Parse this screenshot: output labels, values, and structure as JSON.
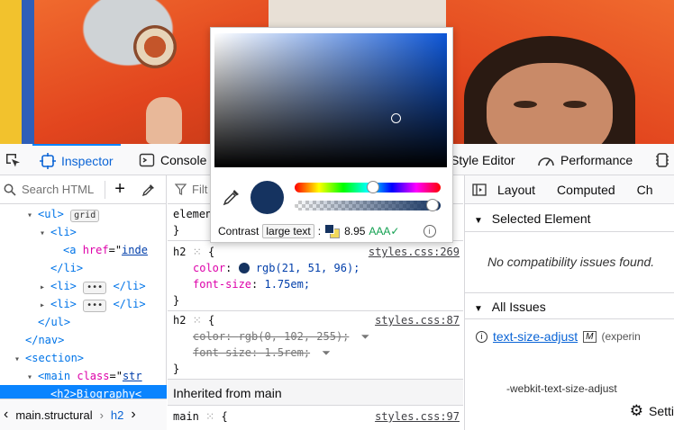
{
  "toolbar": {
    "inspector_label": "Inspector",
    "console_label": "Console",
    "style_editor_label": "Style Editor",
    "performance_label": "Performance"
  },
  "markup": {
    "search_placeholder": "Search HTML",
    "rows": [
      {
        "indent": 2,
        "twisty": "▾",
        "open": "<ul>",
        "badge": "grid"
      },
      {
        "indent": 3,
        "twisty": "▾",
        "open": "<li>"
      },
      {
        "indent": 4,
        "twisty": "",
        "open": "<a",
        "attr": "href",
        "val": "inde"
      },
      {
        "indent": 3,
        "twisty": "",
        "open": "</li>"
      },
      {
        "indent": 3,
        "twisty": "▸",
        "open": "<li>",
        "badge": "•••",
        "close": "</li>"
      },
      {
        "indent": 3,
        "twisty": "▸",
        "open": "<li>",
        "badge": "•••",
        "close": "</li>"
      },
      {
        "indent": 2,
        "twisty": "",
        "open": "</ul>"
      },
      {
        "indent": 1,
        "twisty": "",
        "open": "</nav>"
      },
      {
        "indent": 1,
        "twisty": "▾",
        "open": "<section>"
      },
      {
        "indent": 2,
        "twisty": "▾",
        "open": "<main",
        "attr": "class",
        "val": "str"
      },
      {
        "indent": 3,
        "twisty": "",
        "open": "<h2>Biography<",
        "selected": true
      }
    ],
    "breadcrumbs": [
      "main.structural",
      "h2"
    ]
  },
  "rules": {
    "filter_placeholder": "Filt",
    "element_label": "elemen",
    "element_close": "}",
    "rule1": {
      "selector": "h2",
      "source": "styles.css:269",
      "color_prop": "color",
      "color_val": "rgb(21, 51, 96);",
      "font_prop": "font-size",
      "font_val": "1.75em;",
      "close": "}"
    },
    "rule2": {
      "selector": "h2",
      "source": "styles.css:87",
      "color_prop": "color",
      "color_val": "rgb(0, 102, 255);",
      "font_prop": "font-size",
      "font_val": "1.5rem;",
      "close": "}"
    },
    "inherited_label": "Inherited from main",
    "rule3": {
      "selector": "main",
      "source": "styles.css:97"
    }
  },
  "side": {
    "tabs": [
      "Layout",
      "Computed",
      "Ch"
    ],
    "selected_element": "Selected Element",
    "no_issues": "No compatibility issues found.",
    "all_issues": "All Issues",
    "issue_prop": "text-size-adjust",
    "issue_note": "(experin",
    "issue_detail": "-webkit-text-size-adjust",
    "settings_label": "Setti"
  },
  "picker": {
    "color": "#153360",
    "contrast_label": "Contrast",
    "contrast_tag": "large text",
    "contrast_colon": ":",
    "contrast_ratio": "8.95",
    "contrast_grade": "AAA✓"
  },
  "colors": {
    "accent": "#0a84ff",
    "tag": "#0074e8",
    "swatch_red": "#e0442a"
  }
}
